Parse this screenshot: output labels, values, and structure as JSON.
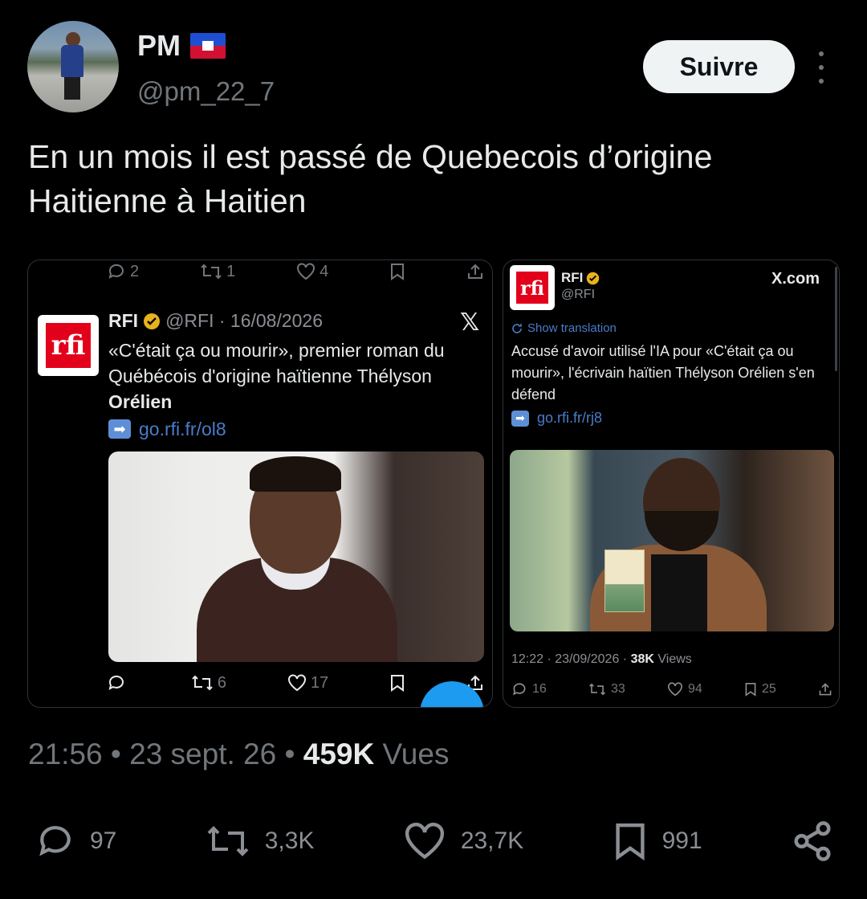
{
  "author": {
    "name": "PM",
    "handle": "@pm_22_7"
  },
  "follow_label": "Suivre",
  "tweet_text": "En un mois il est passé de Quebecois d’origine Haitienne à Haitien",
  "left_card": {
    "top_actions": {
      "replies": "2",
      "reposts": "1",
      "likes": "4"
    },
    "source": "RFI",
    "meta": "@RFI · 16/08/2026",
    "text_main": "«C'était ça ou mourir», premier roman du Québécois d'origine haïtienne Thélyson",
    "text_bold": "Orélien",
    "link": "go.rfi.fr/ol8",
    "bottom_actions": {
      "replies": "",
      "reposts": "6",
      "likes": "17"
    }
  },
  "right_card": {
    "source": "RFI",
    "handle": "@RFI",
    "site": "X.com",
    "translate": "Show translation",
    "text": "Accusé d'avoir utilisé l'IA pour «C'était ça ou mourir», l'écrivain haïtien Thélyson Orélien s'en défend",
    "link": "go.rfi.fr/rj8",
    "timestamp": "12:22 · 23/09/2026 ·",
    "views_count": "38K",
    "views_label": "Views",
    "actions": {
      "replies": "16",
      "reposts": "33",
      "likes": "94",
      "bookmarks": "25"
    }
  },
  "logo_text": "rfi",
  "footer": {
    "time": "21:56",
    "date": "23 sept. 26",
    "views_count": "459K",
    "views_label": "Vues",
    "sep": "•"
  },
  "stats": {
    "replies": "97",
    "reposts": "3,3K",
    "likes": "23,7K",
    "bookmarks": "991"
  }
}
